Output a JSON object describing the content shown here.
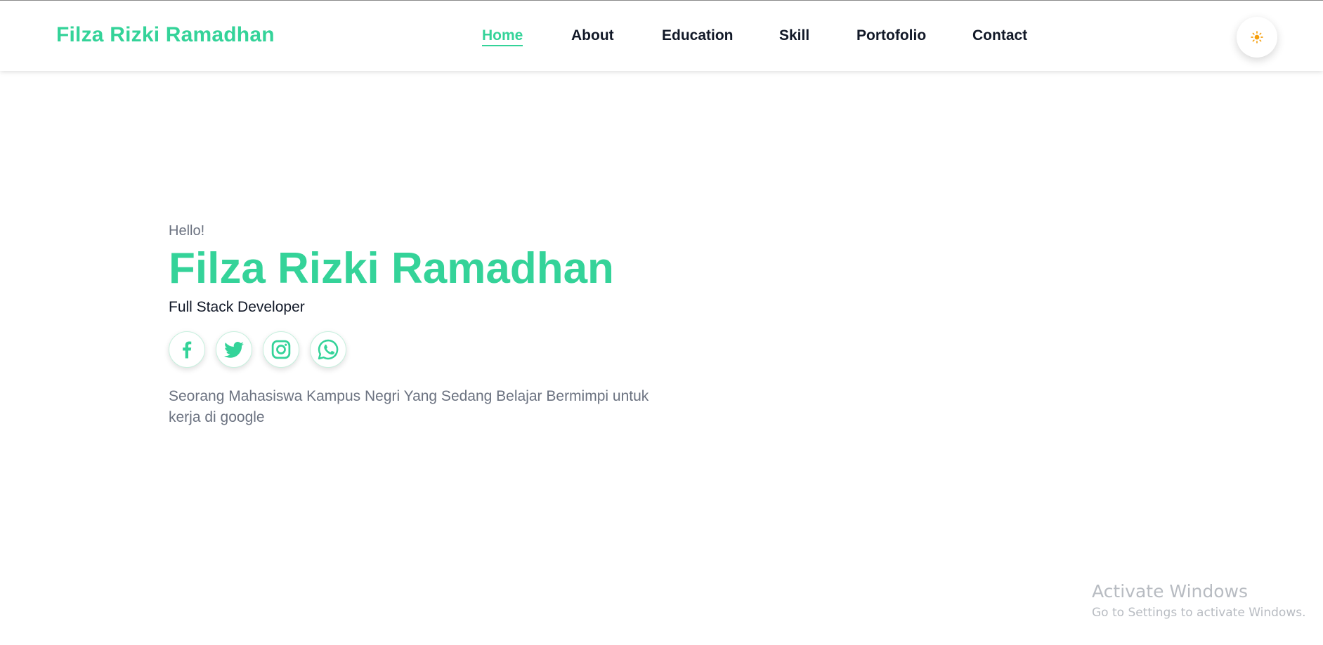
{
  "colors": {
    "accent": "#34d399",
    "text": "#111827",
    "muted": "#6b7280",
    "sun": "#f59e0b"
  },
  "navbar": {
    "brand": "Filza Rizki Ramadhan",
    "links": [
      {
        "label": "Home",
        "active": true
      },
      {
        "label": "About",
        "active": false
      },
      {
        "label": "Education",
        "active": false
      },
      {
        "label": "Skill",
        "active": false
      },
      {
        "label": "Portofolio",
        "active": false
      },
      {
        "label": "Contact",
        "active": false
      }
    ],
    "theme_toggle_icon": "sun-icon"
  },
  "hero": {
    "greeting": "Hello!",
    "name": "Filza Rizki Ramadhan",
    "role": "Full Stack Developer",
    "socials": [
      {
        "icon": "facebook-icon"
      },
      {
        "icon": "twitter-icon"
      },
      {
        "icon": "instagram-icon"
      },
      {
        "icon": "whatsapp-icon"
      }
    ],
    "description": "Seorang Mahasiswa Kampus Negri Yang Sedang Belajar Bermimpi untuk kerja di google"
  },
  "watermark": {
    "title": "Activate Windows",
    "subtitle": "Go to Settings to activate Windows."
  }
}
